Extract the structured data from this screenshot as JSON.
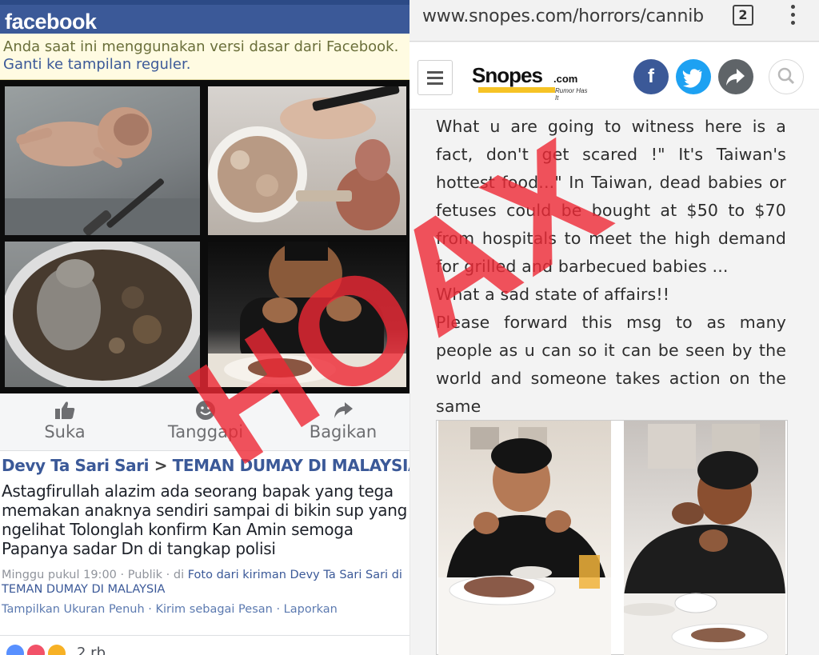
{
  "facebook": {
    "logo": "facebook",
    "notice": {
      "text": "Anda saat ini menggunakan versi dasar dari Facebook.",
      "link": "Ganti ke tampilan reguler."
    },
    "actions": {
      "like": "Suka",
      "react": "Tanggapi",
      "share": "Bagikan"
    },
    "post": {
      "author": "Devy Ta Sari Sari",
      "separator": ">",
      "group": "TEMAN DUMAY DI MALAYSIA",
      "text": "Astagfirullah alazim ada seorang bapak yang tega memakan anaknya sendiri sampai di bikin sup yang ngelihat Tolonglah konfirm Kan Amin semoga Papanya sadar Dn di tangkap polisi",
      "meta_time": "Minggu pukul 19:00 · Publik · di ",
      "meta_link": "Foto dari kiriman Devy Ta Sari Sari di TEMAN DUMAY DI MALAYSIA",
      "links": "Tampilkan Ukuran Penuh · Kirim sebagai Pesan · Laporkan"
    },
    "reactions_count": "2 rb",
    "colors": {
      "brand": "#3b5998",
      "link": "#3b5998",
      "notice_bg": "#fffbe2"
    }
  },
  "snopes": {
    "url": "www.snopes.com/horrors/cannib",
    "tab_count": "2",
    "logo": {
      "word": "Snopes",
      "domain": ".com",
      "tagline": "Rumor Has It"
    },
    "share_icons": [
      "facebook-icon",
      "twitter-icon",
      "share-icon",
      "search-icon"
    ],
    "facebook_letter": "f",
    "article": {
      "p1": "What u are going to witness here is a fact, don't get scared !\" It's Taiwan's hottest food...\" In Taiwan, dead babies or fetuses could be bought at $50 to $70 from hospitals to meet the high demand for grilled and barbecued babies ...",
      "p2": "What a sad state of affairs!!",
      "p3": "Please forward this msg to as many people as u can so it can be seen by the world and someone takes action on the same"
    },
    "colors": {
      "facebook": "#3b5998",
      "twitter": "#1da1f2",
      "share": "#5f6468",
      "logo_accent": "#f6c325"
    }
  },
  "stamp": {
    "text": "HOAX",
    "color": "#ee2834"
  }
}
